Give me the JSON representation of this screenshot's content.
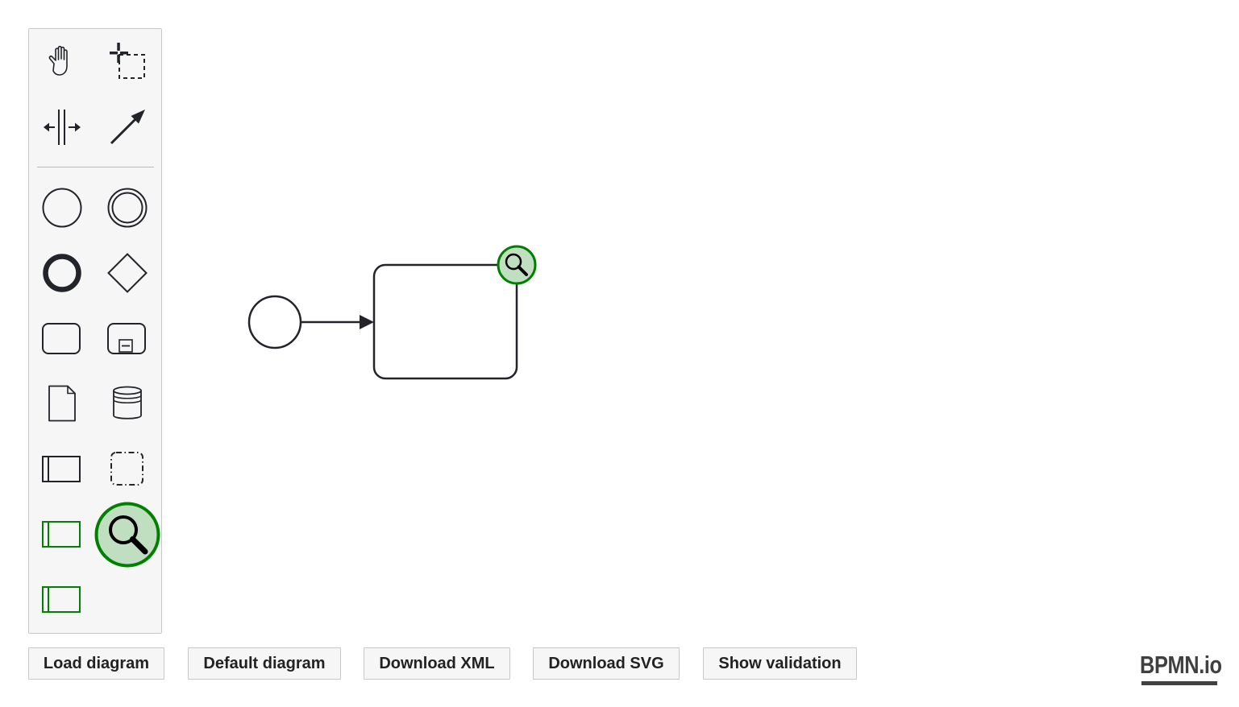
{
  "palette": {
    "tools": [
      {
        "name": "hand-tool-icon",
        "title": "Activate the hand tool"
      },
      {
        "name": "lasso-tool-icon",
        "title": "Activate the lasso tool"
      },
      {
        "name": "space-tool-icon",
        "title": "Activate the create/remove space tool"
      },
      {
        "name": "global-connect-tool-icon",
        "title": "Activate the global connect tool"
      },
      {
        "name": "start-event-icon",
        "title": "Create StartEvent"
      },
      {
        "name": "intermediate-event-icon",
        "title": "Create Intermediate/Boundary Event"
      },
      {
        "name": "end-event-icon",
        "title": "Create EndEvent"
      },
      {
        "name": "gateway-icon",
        "title": "Create Gateway"
      },
      {
        "name": "task-icon",
        "title": "Create Task"
      },
      {
        "name": "subprocess-icon",
        "title": "Create expanded SubProcess"
      },
      {
        "name": "data-object-icon",
        "title": "Create DataObjectReference"
      },
      {
        "name": "data-store-icon",
        "title": "Create DataStoreReference"
      },
      {
        "name": "participant-icon",
        "title": "Create Pool/Participant"
      },
      {
        "name": "group-icon",
        "title": "Create Group"
      },
      {
        "name": "custom-participant-icon",
        "title": "Create custom participant"
      },
      {
        "name": "validation-search-icon",
        "title": "Validation"
      },
      {
        "name": "custom-participant-alt-icon",
        "title": "Create custom participant"
      }
    ]
  },
  "buttons": {
    "load": "Load diagram",
    "default": "Default diagram",
    "download_xml": "Download XML",
    "download_svg": "Download SVG",
    "show_validation": "Show validation"
  },
  "diagram": {
    "elements": [
      "start-event",
      "sequence-flow",
      "task"
    ],
    "badge": "search-icon"
  },
  "colors": {
    "stroke": "#22242a",
    "accent_green": "#008000",
    "accent_green_fill": "#c0dfc0",
    "palette_bg": "#f6f6f6"
  },
  "logo": {
    "text": "BPMN.io"
  }
}
